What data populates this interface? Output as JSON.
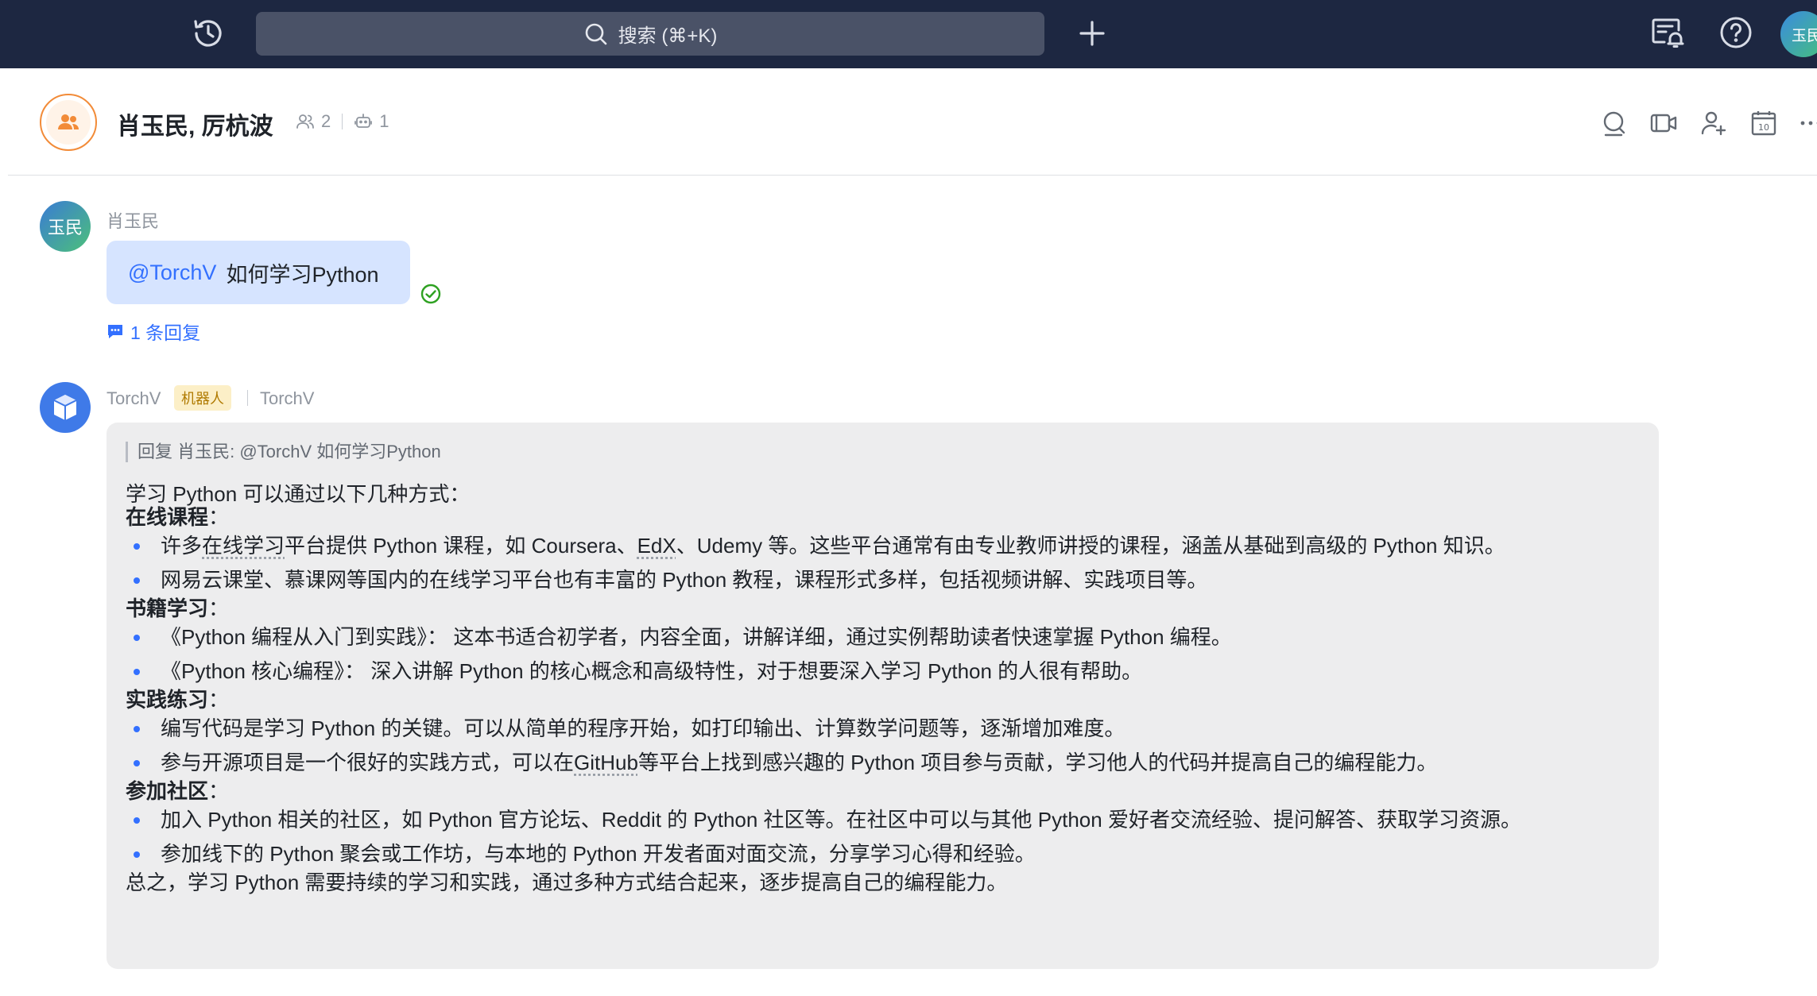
{
  "topbar": {
    "search_placeholder": "搜索 (⌘+K)",
    "user_avatar_text": "玉民"
  },
  "chat": {
    "title": "肖玉民, 厉杭波",
    "member_count": "2",
    "bot_count": "1"
  },
  "messages": [
    {
      "avatar_text": "玉民",
      "sender": "肖玉民",
      "mention": "@TorchV",
      "text": "如何学习Python",
      "reply_count_label": "1 条回复"
    },
    {
      "sender": "TorchV",
      "badge": "机器人",
      "app_name": "TorchV",
      "quote": "回复 肖玉民: @TorchV 如何学习Python",
      "intro": "学习 Python 可以通过以下几种方式：",
      "sections": [
        {
          "heading": "在线课程",
          "colon": "：",
          "bullets": [
            [
              "许多",
              "在线学习",
              "平台提供 Python 课程，如 Coursera、",
              "EdX",
              "、Udemy 等。这些平台通常有由专业教师讲授的课程，涵盖从基础到高级的 Python 知识。"
            ],
            [
              "网易云课堂、慕课网等国内的在线学习平台也有丰富的 Python 教程，课程形式多样，包括视频讲解、实践项目等。"
            ]
          ]
        },
        {
          "heading": "书籍学习",
          "colon": "：",
          "bullets": [
            [
              "《Python 编程从入门到实践》： 这本书适合初学者，内容全面，讲解详细，通过实例帮助读者快速掌握 Python 编程。"
            ],
            [
              "《Python 核心编程》： 深入讲解 Python 的核心概念和高级特性，对于想要深入学习 Python 的人很有帮助。"
            ]
          ]
        },
        {
          "heading": "实践练习",
          "colon": "：",
          "bullets": [
            [
              "编写代码是学习 Python 的关键。可以从简单的程序开始，如打印输出、计算数学问题等，逐渐增加难度。"
            ],
            [
              "参与开源项目是一个很好的实践方式，可以在 ",
              "GitHub",
              " 等平台上找到感兴趣的 Python 项目参与贡献，学习他人的代码并提高自己的编程能力。"
            ]
          ]
        },
        {
          "heading": "参加社区",
          "colon": "：",
          "bullets": [
            [
              "加入 Python 相关的社区，如 Python 官方论坛、Reddit 的 Python 社区等。在社区中可以与其他 Python 爱好者交流经验、提问解答、获取学习资源。"
            ],
            [
              "参加线下的 Python 聚会或工作坊，与本地的 Python 开发者面对面交流，分享学习心得和经验。"
            ]
          ]
        }
      ],
      "conclusion": "总之，学习 Python 需要持续的学习和实践，通过多种方式结合起来，逐步提高自己的编程能力。"
    }
  ],
  "header_action_icons": [
    "search-icon",
    "video-call-icon",
    "add-member-icon",
    "calendar-icon",
    "more-icon"
  ],
  "calendar_day": "10",
  "colors": {
    "topbar_bg": "#1d2741",
    "search_bg": "#4a5267",
    "accent_blue": "#3370ff",
    "bubble_blue": "#d6e4ff",
    "card_bg": "#ededee",
    "group_accent": "#f28b38",
    "bot_badge_bg": "#fcefc7",
    "read_green": "#2ea121"
  }
}
